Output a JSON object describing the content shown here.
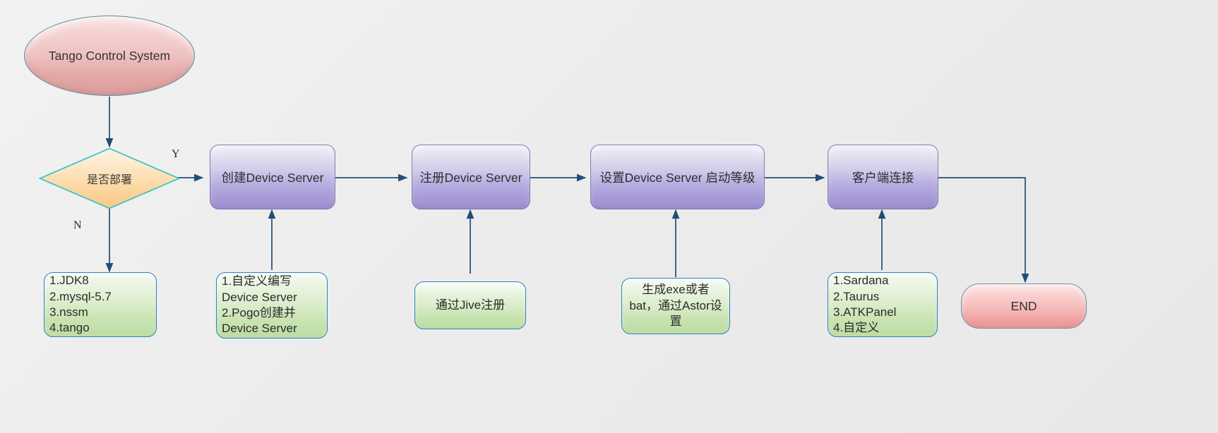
{
  "diagram": {
    "title": "Tango Control System deployment flowchart",
    "colors": {
      "background": "#eeeeee",
      "terminator_fill": "#eec3c2",
      "terminator_border": "#5b8c9e",
      "decision_fill": "#fbdcab",
      "decision_border": "#2fc0c8",
      "process_fill": "#b7ade0",
      "process_border": "#7b7fb5",
      "detail_fill": "#cfe7b8",
      "detail_border": "#2a82c4",
      "edge": "#1f4e79"
    }
  },
  "nodes": {
    "start": {
      "label": "Tango Control System",
      "shape": "ellipse"
    },
    "decision": {
      "label": "是否部署",
      "shape": "diamond"
    },
    "process1": {
      "label": "创建Device Server",
      "shape": "rounded-rect"
    },
    "process2": {
      "label": "注册Device Server",
      "shape": "rounded-rect"
    },
    "process3": {
      "label": "设置Device Server 启动等级",
      "shape": "rounded-rect"
    },
    "process4": {
      "label": "客户端连接",
      "shape": "rounded-rect"
    },
    "end": {
      "label": "END",
      "shape": "rounded-rect"
    }
  },
  "details": {
    "prereq": {
      "lines": [
        "1.JDK8",
        "2.mysql-5.7",
        "3.nssm",
        "4.tango"
      ]
    },
    "create": {
      "lines": [
        "1.自定义编写",
        "Device Server",
        "2.Pogo创建并",
        "Device Server"
      ]
    },
    "register": {
      "lines": [
        "通过Jive注册"
      ]
    },
    "startup": {
      "lines": [
        "生成exe或者",
        "bat，通过Astor设",
        "置"
      ]
    },
    "client": {
      "lines": [
        "1.Sardana",
        "2.Taurus",
        "3.ATKPanel",
        "4.自定义"
      ]
    }
  },
  "edge_labels": {
    "yes": "Y",
    "no": "N"
  }
}
